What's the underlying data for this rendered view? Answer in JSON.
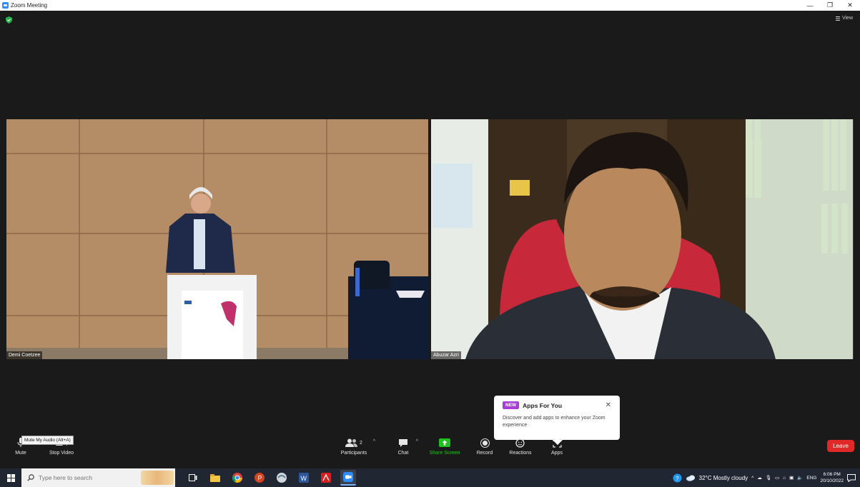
{
  "window": {
    "title": "Zoom Meeting"
  },
  "top_right": {
    "view_label": "View"
  },
  "participants_video": [
    {
      "name": "Demi Coetzee"
    },
    {
      "name": "Abuzar Azri"
    }
  ],
  "apps_popup": {
    "badge": "NEW",
    "title": "Apps For You",
    "description": "Discover and add apps to enhance your Zoom experience"
  },
  "tooltip": "Mute My Audio (Alt+A)",
  "toolbar": {
    "mute": "Mute",
    "stop_video": "Stop Video",
    "participants": "Participants",
    "participants_count": "2",
    "chat": "Chat",
    "share_screen": "Share Screen",
    "record": "Record",
    "reactions": "Reactions",
    "apps": "Apps",
    "leave": "Leave"
  },
  "taskbar": {
    "search_placeholder": "Type here to search",
    "weather": "32°C  Mostly cloudy",
    "language": "ENG",
    "time": "6:06 PM",
    "date": "20/10/2022"
  },
  "colors": {
    "background": "#1a1a1a",
    "share_green": "#1ec11e",
    "leave_red": "#e02828",
    "new_badge": "#a63fd6",
    "zoom_blue": "#2d8cff"
  }
}
